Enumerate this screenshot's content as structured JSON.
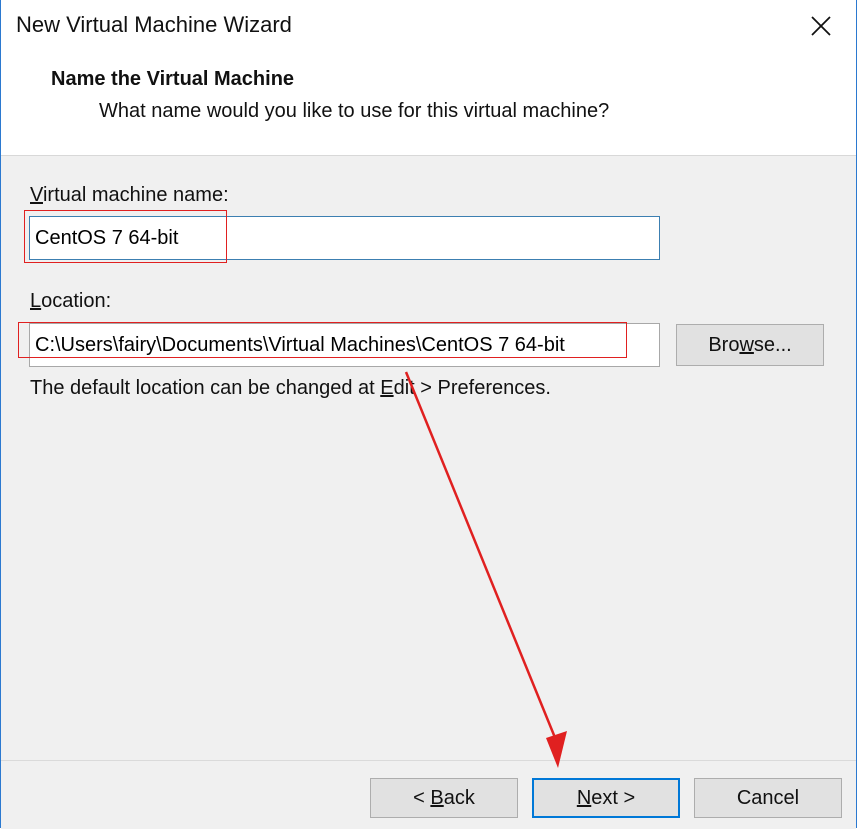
{
  "window": {
    "title": "New Virtual Machine Wizard"
  },
  "header": {
    "title": "Name the Virtual Machine",
    "subtitle": "What name would you like to use for this virtual machine?"
  },
  "form": {
    "name_label_accel": "V",
    "name_label_rest": "irtual machine name:",
    "name_value": "CentOS 7 64-bit",
    "location_label_accel": "L",
    "location_label_rest": "ocation:",
    "location_value": "C:\\Users\\fairy\\Documents\\Virtual Machines\\CentOS 7 64-bit",
    "browse_accel": "w",
    "browse_pre": "Bro",
    "browse_post": "se...",
    "hint_pre": "The default location can be changed at ",
    "hint_accel": "E",
    "hint_post": "dit > Preferences."
  },
  "footer": {
    "back_pre": "< ",
    "back_accel": "B",
    "back_post": "ack",
    "next_accel": "N",
    "next_post": "ext >",
    "cancel_label": "Cancel"
  },
  "colors": {
    "accent": "#0078d7",
    "annotation": "#e02020",
    "content_bg": "#f0f0f0"
  },
  "icons": {
    "close": "close-icon"
  }
}
